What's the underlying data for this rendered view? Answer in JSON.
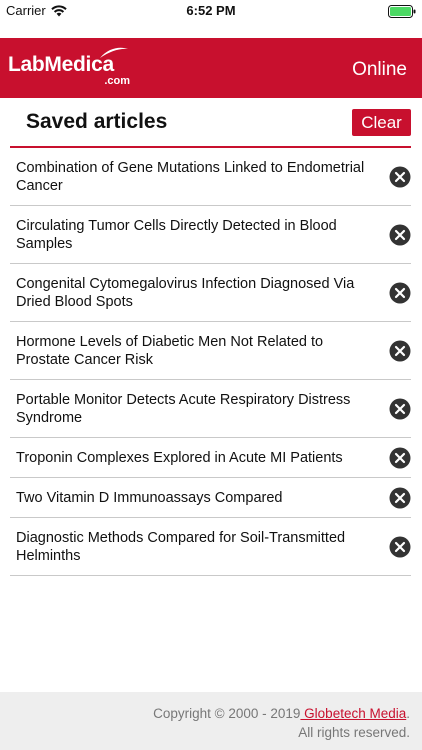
{
  "status_bar": {
    "carrier": "Carrier",
    "time": "6:52 PM",
    "battery_color": "#4cd964"
  },
  "header": {
    "logo_main": "LabMedica",
    "logo_sub": ".com",
    "status": "Online",
    "background_color": "#c8102e"
  },
  "main": {
    "title": "Saved articles",
    "clear_label": "Clear",
    "articles": [
      {
        "title": "Combination of Gene Mutations Linked to Endometrial Cancer"
      },
      {
        "title": "Circulating Tumor Cells Directly Detected in Blood Samples"
      },
      {
        "title": "Congenital Cytomegalovirus Infection Diagnosed Via Dried Blood Spots"
      },
      {
        "title": "Hormone Levels of Diabetic Men Not Related to Prostate Cancer Risk"
      },
      {
        "title": "Portable Monitor Detects Acute Respiratory Distress Syndrome"
      },
      {
        "title": "Troponin Complexes Explored in Acute MI Patients"
      },
      {
        "title": "Two Vitamin D Immunoassays Compared"
      },
      {
        "title": "Diagnostic Methods Compared for Soil-Transmitted Helminths"
      }
    ],
    "remove_icon": "close-circle-icon"
  },
  "footer": {
    "copyright": "Copyright © 2000 - 2019",
    "link_text": " Globetech Media",
    "period": ".",
    "rights": "All rights reserved."
  }
}
